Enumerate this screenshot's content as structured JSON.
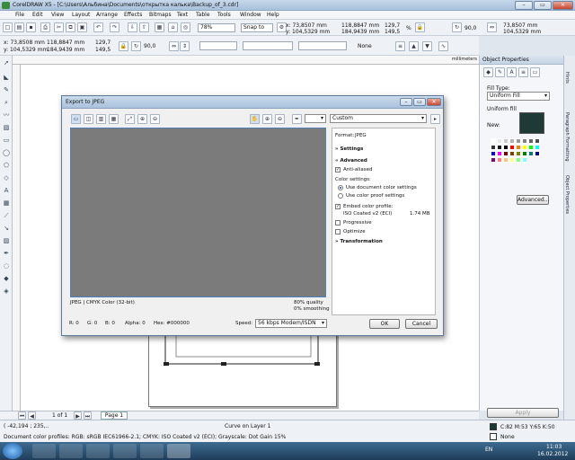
{
  "window": {
    "title": "CorelDRAW X5 - [C:\\Users\\Альбина\\Documents\\открытка калька\\Backup_of_3.cdr]"
  },
  "menu": [
    "File",
    "Edit",
    "View",
    "Layout",
    "Arrange",
    "Effects",
    "Bitmaps",
    "Text",
    "Table",
    "Tools",
    "Window",
    "Help"
  ],
  "toolbar": {
    "zoom": "78%",
    "snap": "Snap to"
  },
  "property_bar": {
    "x": "x: 73,8508 mm",
    "y": "y: 104,5329 mm",
    "w": "118,8847 mm",
    "h": "184,9439 mm",
    "sx": "129,7",
    "sy": "149,5",
    "pct": "%",
    "angle": "90,0",
    "outline": "None",
    "x2": "x: 73,8507 mm",
    "y2": "y: 104,5329 mm",
    "w2": "118,8847 mm",
    "h2": "184,9439 mm",
    "angle2": "90,0",
    "right_x": "73,8507 mm",
    "right_y": "104,5329 mm"
  },
  "ruler": {
    "unit": "millimeters"
  },
  "dialog": {
    "title": "Export to JPEG",
    "preset": "Custom",
    "format_label": "Format:",
    "format_value": "JPEG",
    "settings": "Settings",
    "advanced": "Advanced",
    "anti_aliased": "Anti-aliased",
    "color_settings": "Color settings:",
    "use_doc_profile": "Use document color settings",
    "use_proof_profile": "Use color proof settings",
    "embed_profile": "Embed color profile:",
    "profile_name": "ISO Coated v2 (ECI)",
    "profile_size": "1.74 MB",
    "progressive": "Progressive",
    "optimize": "Optimize",
    "transformation": "Transformation",
    "info_left": "JPEG  |  CMYK Color (32-bit)",
    "info_right1": "80% quality",
    "info_right2": "0% smoothing",
    "r": "R: 0",
    "g": "G: 0",
    "b": "B: 0",
    "alpha": "Alpha: 0",
    "hex": "Hex: #000000",
    "speed_label": "Speed:",
    "speed": "56 kbps Modem/ISDN",
    "ok": "OK",
    "cancel": "Cancel"
  },
  "docker": {
    "title": "Object Properties",
    "fill_type_label": "Fill Type:",
    "fill_type": "Uniform Fill",
    "uniform_fill": "Uniform fill",
    "new_label": "New:",
    "new_color": "#1d3a36",
    "advanced_btn": "Advanced...",
    "apply_btn": "Apply",
    "tabs": [
      "Object Properties",
      "Paragraph Formatting",
      "Hints"
    ]
  },
  "pages": {
    "counter": "1 of 1",
    "tab": "Page 1"
  },
  "status": {
    "coords": "( -42,194 ; 235,..",
    "layer": "Curve on Layer 1",
    "profiles": "Document color profiles: RGB: sRGB IEC61966-2.1; CMYK: ISO Coated v2 (ECI); Grayscale: Dot Gain 15%",
    "fill_info": "C:82 M:53 Y:65 K:50",
    "outline_info": "None"
  },
  "taskbar": {
    "lang": "EN",
    "time": "11:03",
    "date": "16.02.2012"
  },
  "palette_colors": [
    "#ffffff",
    "#e6e6e6",
    "#cccccc",
    "#b3b3b3",
    "#999999",
    "#808080",
    "#666666",
    "#4d4d4d",
    "#333333",
    "#1a1a1a",
    "#000000",
    "#ff0000",
    "#ff8000",
    "#ffff00",
    "#00ff00",
    "#00ffff",
    "#0000ff",
    "#ff00ff",
    "#800000",
    "#804000",
    "#808000",
    "#008000",
    "#008080",
    "#000080",
    "#800080",
    "#ff8080",
    "#ffc080",
    "#ffff80",
    "#80ff80",
    "#80ffff"
  ]
}
